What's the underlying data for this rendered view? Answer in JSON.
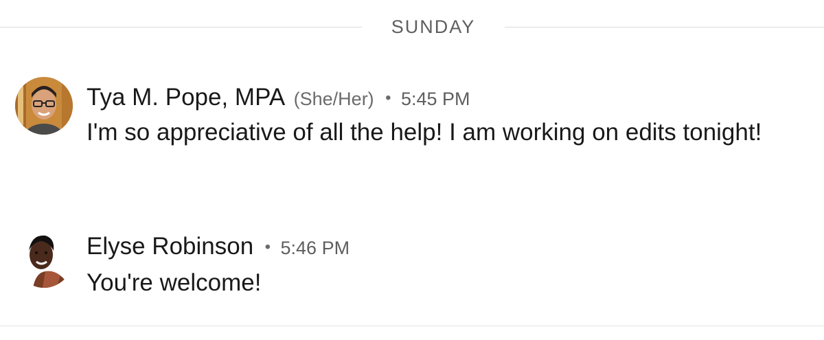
{
  "divider": {
    "label": "SUNDAY"
  },
  "messages": [
    {
      "sender": "Tya M. Pope, MPA",
      "pronouns": "(She/Her)",
      "separator": "•",
      "time": "5:45 PM",
      "text": "I'm so appreciative of all the help! I am working on edits tonight!"
    },
    {
      "sender": "Elyse Robinson",
      "separator": "•",
      "time": "5:46 PM",
      "text": "You're welcome!"
    }
  ],
  "colors": {
    "text_primary": "#191919",
    "text_secondary": "#5e5e5e",
    "divider_line": "#dcdcdc"
  }
}
